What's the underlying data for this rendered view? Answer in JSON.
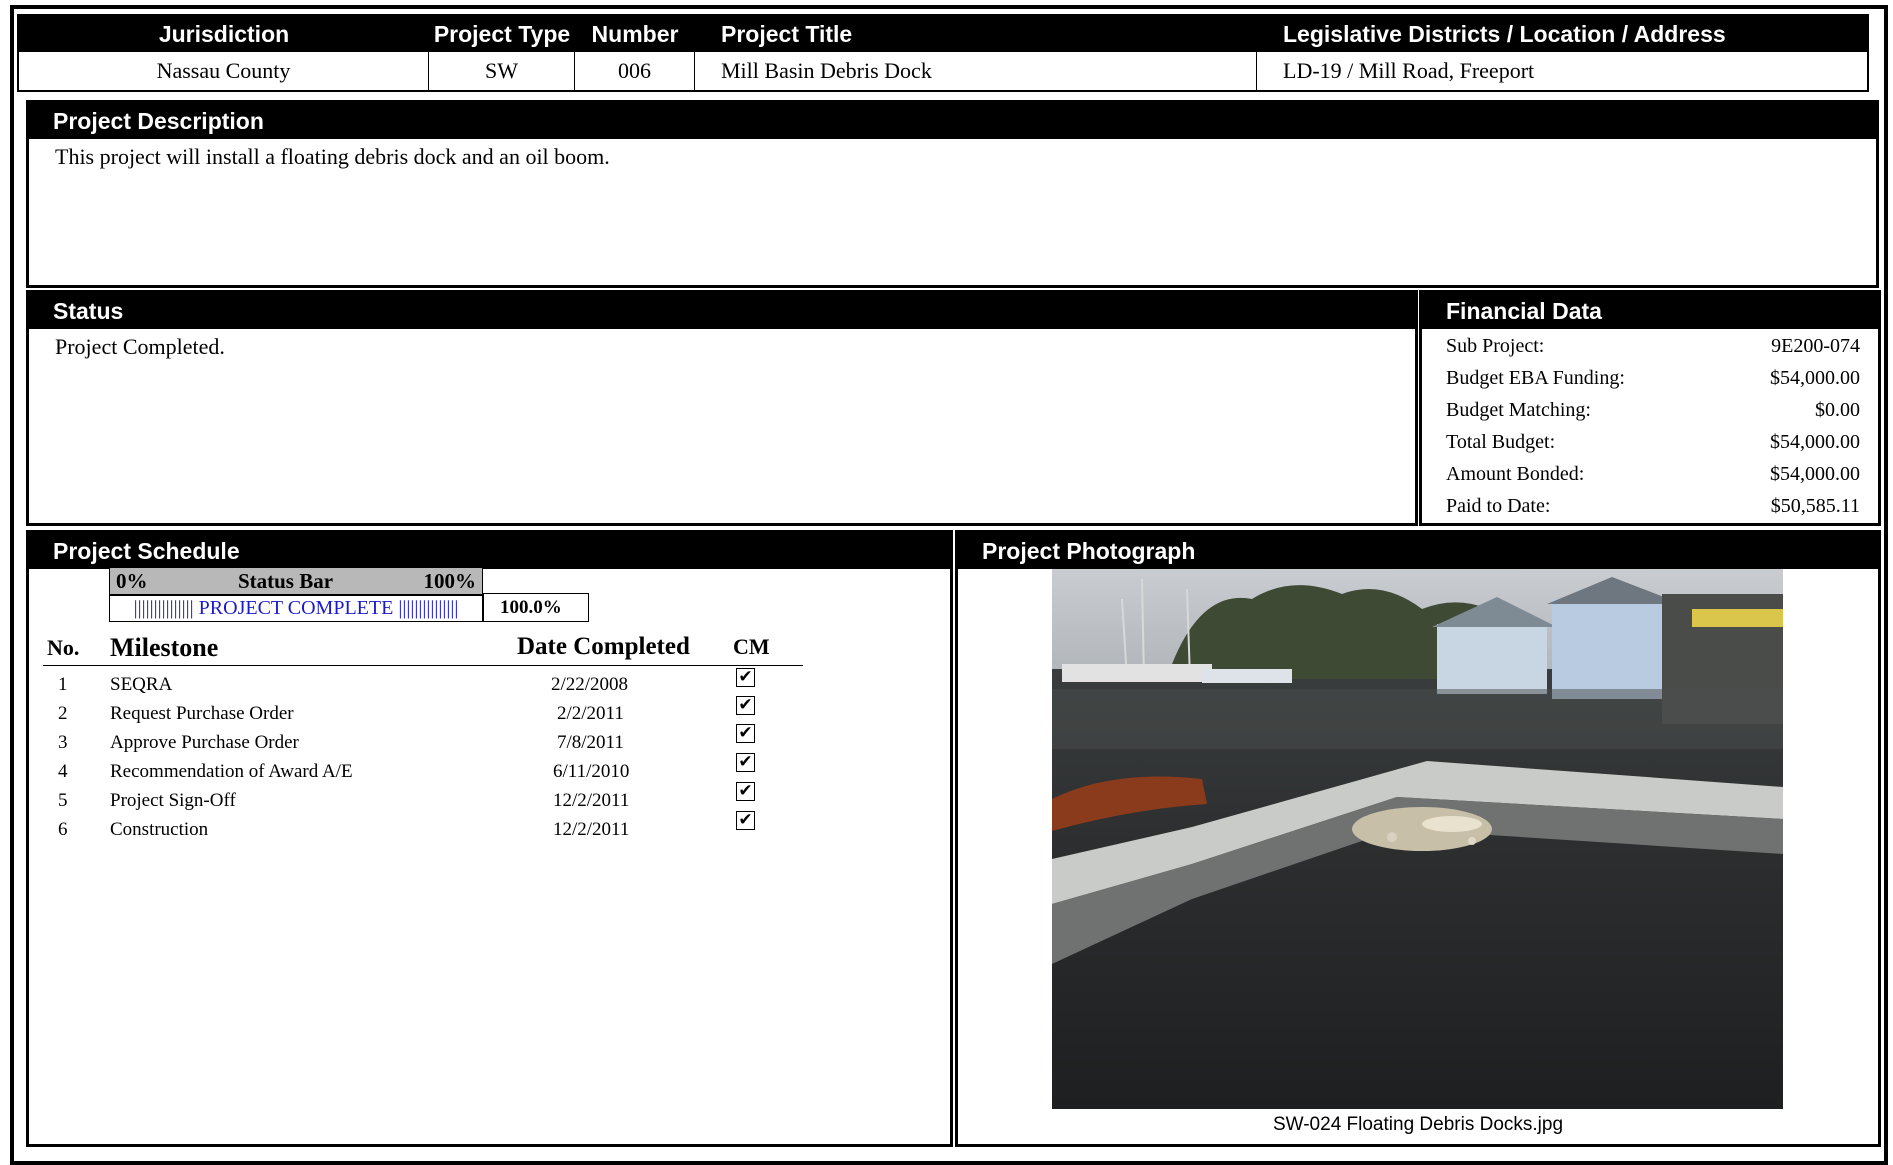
{
  "header": {
    "columns": [
      "Jurisdiction",
      "Project Type",
      "Number",
      "Project Title",
      "Legislative Districts / Location / Address"
    ],
    "values": [
      "Nassau County",
      "SW",
      "006",
      "Mill Basin Debris Dock",
      "LD-19 / Mill Road, Freeport"
    ]
  },
  "description": {
    "title": "Project Description",
    "text": "This project will install a floating debris dock and an oil boom."
  },
  "status": {
    "title": "Status",
    "text": "Project Completed."
  },
  "financial": {
    "title": "Financial Data",
    "rows": [
      {
        "label": "Sub Project:",
        "value": "9E200-074"
      },
      {
        "label": "Budget EBA Funding:",
        "value": "$54,000.00"
      },
      {
        "label": "Budget Matching:",
        "value": "$0.00"
      },
      {
        "label": "Total Budget:",
        "value": "$54,000.00"
      },
      {
        "label": "Amount Bonded:",
        "value": "$54,000.00"
      },
      {
        "label": "Paid to Date:",
        "value": "$50,585.11"
      }
    ]
  },
  "schedule": {
    "title": "Project Schedule",
    "status_bar": {
      "left": "0%",
      "label": "Status Bar",
      "right": "100%",
      "bar_text": "||||||||||||||| PROJECT COMPLETE |||||||||||||||",
      "percent": "100.0%",
      "progress": 1.0
    },
    "columns": {
      "no": "No.",
      "milestone": "Milestone",
      "date": "Date Completed",
      "cm": "CM"
    },
    "milestones": [
      {
        "no": "1",
        "name": "SEQRA",
        "date": "2/22/2008",
        "cm": true
      },
      {
        "no": "2",
        "name": "Request Purchase Order",
        "date": "2/2/2011",
        "cm": true
      },
      {
        "no": "3",
        "name": "Approve Purchase Order",
        "date": "7/8/2011",
        "cm": true
      },
      {
        "no": "4",
        "name": "Recommendation of Award A/E",
        "date": "6/11/2010",
        "cm": true
      },
      {
        "no": "5",
        "name": "Project Sign-Off",
        "date": "12/2/2011",
        "cm": true
      },
      {
        "no": "6",
        "name": "Construction",
        "date": "12/2/2011",
        "cm": true
      }
    ]
  },
  "photo": {
    "title": "Project Photograph",
    "caption": "SW-024 Floating Debris Docks.jpg"
  }
}
